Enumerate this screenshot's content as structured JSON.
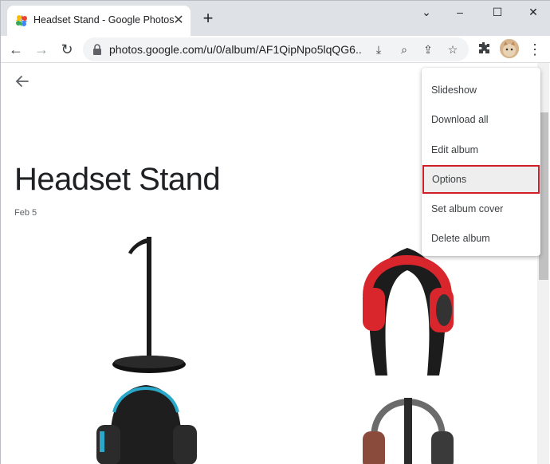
{
  "browser": {
    "tab_title": "Headset Stand - Google Photos",
    "url": "photos.google.com/u/0/album/AF1QipNpo5lqQG6..."
  },
  "album": {
    "title": "Headset Stand",
    "date": "Feb 5"
  },
  "menu": {
    "items": [
      "Slideshow",
      "Download all",
      "Edit album",
      "Options",
      "Set album cover",
      "Delete album"
    ],
    "highlighted_index": 3,
    "highlight_color": "#d11f2a"
  },
  "icons": {
    "favicon": "google-photos-icon",
    "lock": "lock-icon",
    "back": "arrow-left-icon"
  }
}
